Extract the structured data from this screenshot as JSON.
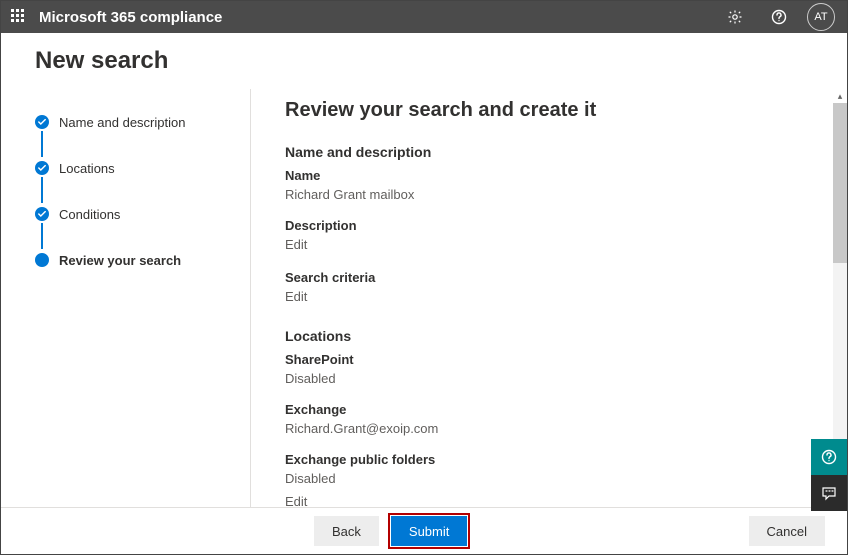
{
  "topbar": {
    "app_title": "Microsoft 365 compliance",
    "avatar_initials": "AT"
  },
  "page": {
    "title": "New search"
  },
  "steps": [
    {
      "label": "Name and description",
      "done": true
    },
    {
      "label": "Locations",
      "done": true
    },
    {
      "label": "Conditions",
      "done": true
    },
    {
      "label": "Review your search",
      "done": false
    }
  ],
  "main": {
    "heading": "Review your search and create it",
    "section_name_desc": "Name and description",
    "name_label": "Name",
    "name_value": "Richard Grant mailbox",
    "description_label": "Description",
    "edit_link": "Edit",
    "search_criteria_label": "Search criteria",
    "locations_head": "Locations",
    "sharepoint_label": "SharePoint",
    "sharepoint_value": "Disabled",
    "exchange_label": "Exchange",
    "exchange_value": "Richard.Grant@exoip.com",
    "expf_label": "Exchange public folders",
    "expf_value": "Disabled"
  },
  "footer": {
    "back": "Back",
    "submit": "Submit",
    "cancel": "Cancel"
  }
}
